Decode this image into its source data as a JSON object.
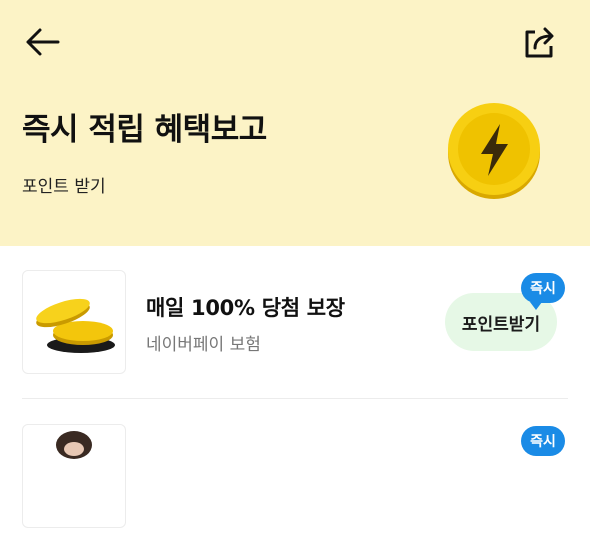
{
  "header": {
    "back_icon": "arrow-left-icon",
    "share_icon": "share-icon",
    "title": "즉시 적립 혜택보고",
    "subtitle": "포인트 받기",
    "coin_icon": "lightning-coin-icon",
    "background_color": "#fcf3c6"
  },
  "list": {
    "items": [
      {
        "title": "매일 100% 당첨 보장",
        "subtitle": "네이버페이 보험",
        "cta_label": "포인트받기",
        "badge": "즉시",
        "thumbnail_icon": "gold-coins-icon"
      },
      {
        "title": "",
        "subtitle": "",
        "cta_label": "",
        "badge": "즉시",
        "thumbnail_icon": "person-photo-thumbnail"
      }
    ]
  },
  "colors": {
    "badge": "#1a8be6",
    "cta_background": "#e6f8e6",
    "coin": "#f2c500"
  }
}
